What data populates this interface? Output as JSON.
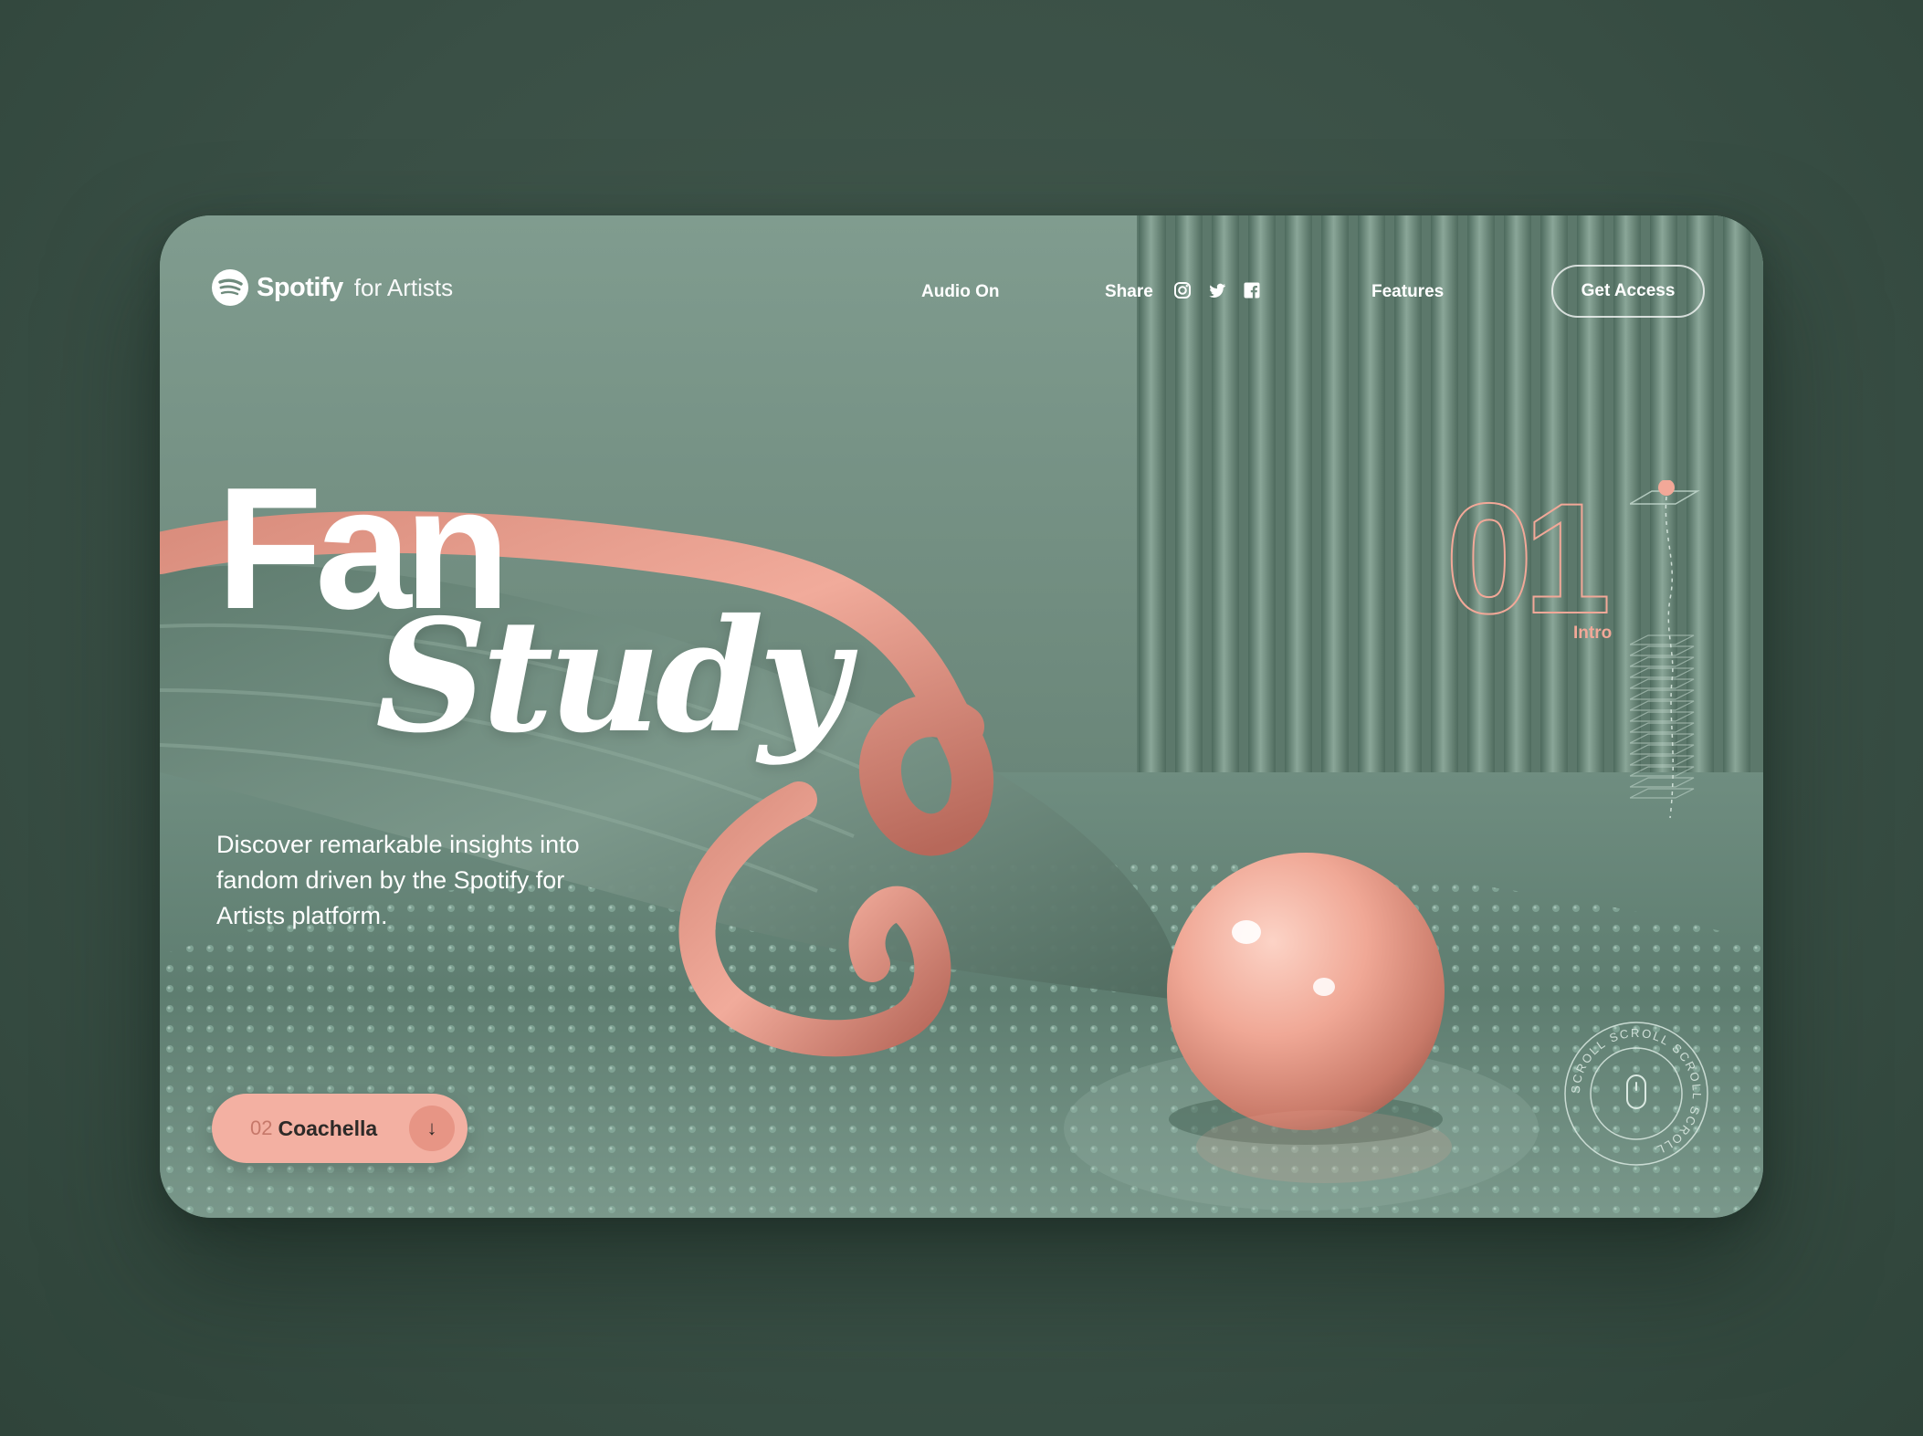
{
  "nav": {
    "brand": "Spotify",
    "brand_suffix": "for Artists",
    "audio_label": "Audio On",
    "share_label": "Share",
    "social_icons": [
      "instagram-icon",
      "twitter-icon",
      "facebook-icon"
    ],
    "features_label": "Features",
    "cta_label": "Get Access"
  },
  "hero": {
    "title_line1": "Fan",
    "title_line2": "Study",
    "tagline": "Discover remarkable insights into fandom driven by the Spotify for Artists platform."
  },
  "next_section": {
    "number": "02",
    "label": "Coachella",
    "icon": "arrow-down-icon"
  },
  "current_section": {
    "number": "01",
    "label": "Intro"
  },
  "scroll_badge": {
    "text": "SCROLL SCROLL SCROLL SCROLL",
    "icon": "mouse-icon"
  },
  "colors": {
    "background": "#3d5449",
    "accent_pink": "#f3b0a2",
    "accent_stroke": "#f2a898",
    "card_green": "#7f9a8d"
  }
}
